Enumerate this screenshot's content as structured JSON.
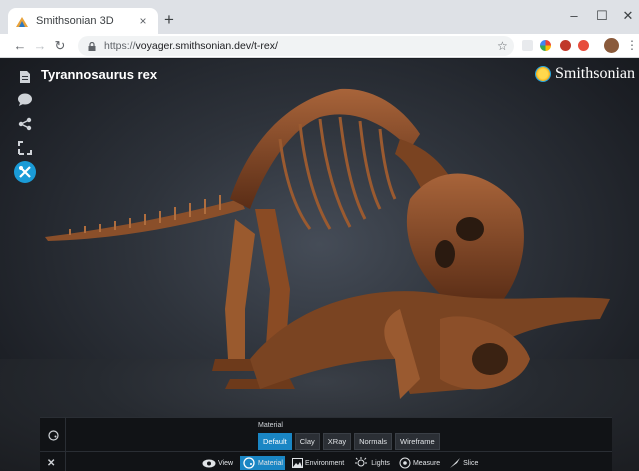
{
  "browser": {
    "tab_title": "Smithsonian 3D",
    "tab_close": "×",
    "new_tab": "+",
    "window_minimize": "–",
    "window_maximize": "☐",
    "window_close": "✕",
    "url_scheme": "https://",
    "url_rest": "voyager.smithsonian.dev/t-rex/"
  },
  "viewer": {
    "title": "Tyrannosaurus rex",
    "brand": "Smithsonian",
    "sidebar_icons": [
      "document-icon",
      "annotation-icon",
      "share-icon",
      "expand-icon",
      "tools-icon"
    ]
  },
  "panel": {
    "material_label": "Material",
    "materials": [
      "Default",
      "Clay",
      "XRay",
      "Normals",
      "Wireframe"
    ],
    "active_material": "Default",
    "tools": [
      "View",
      "Material",
      "Environment",
      "Lights",
      "Measure",
      "Slice"
    ],
    "active_tool": "Material",
    "close": "✕"
  },
  "colors": {
    "accent": "#1a86c4",
    "active_side": "#1a9bd7"
  }
}
